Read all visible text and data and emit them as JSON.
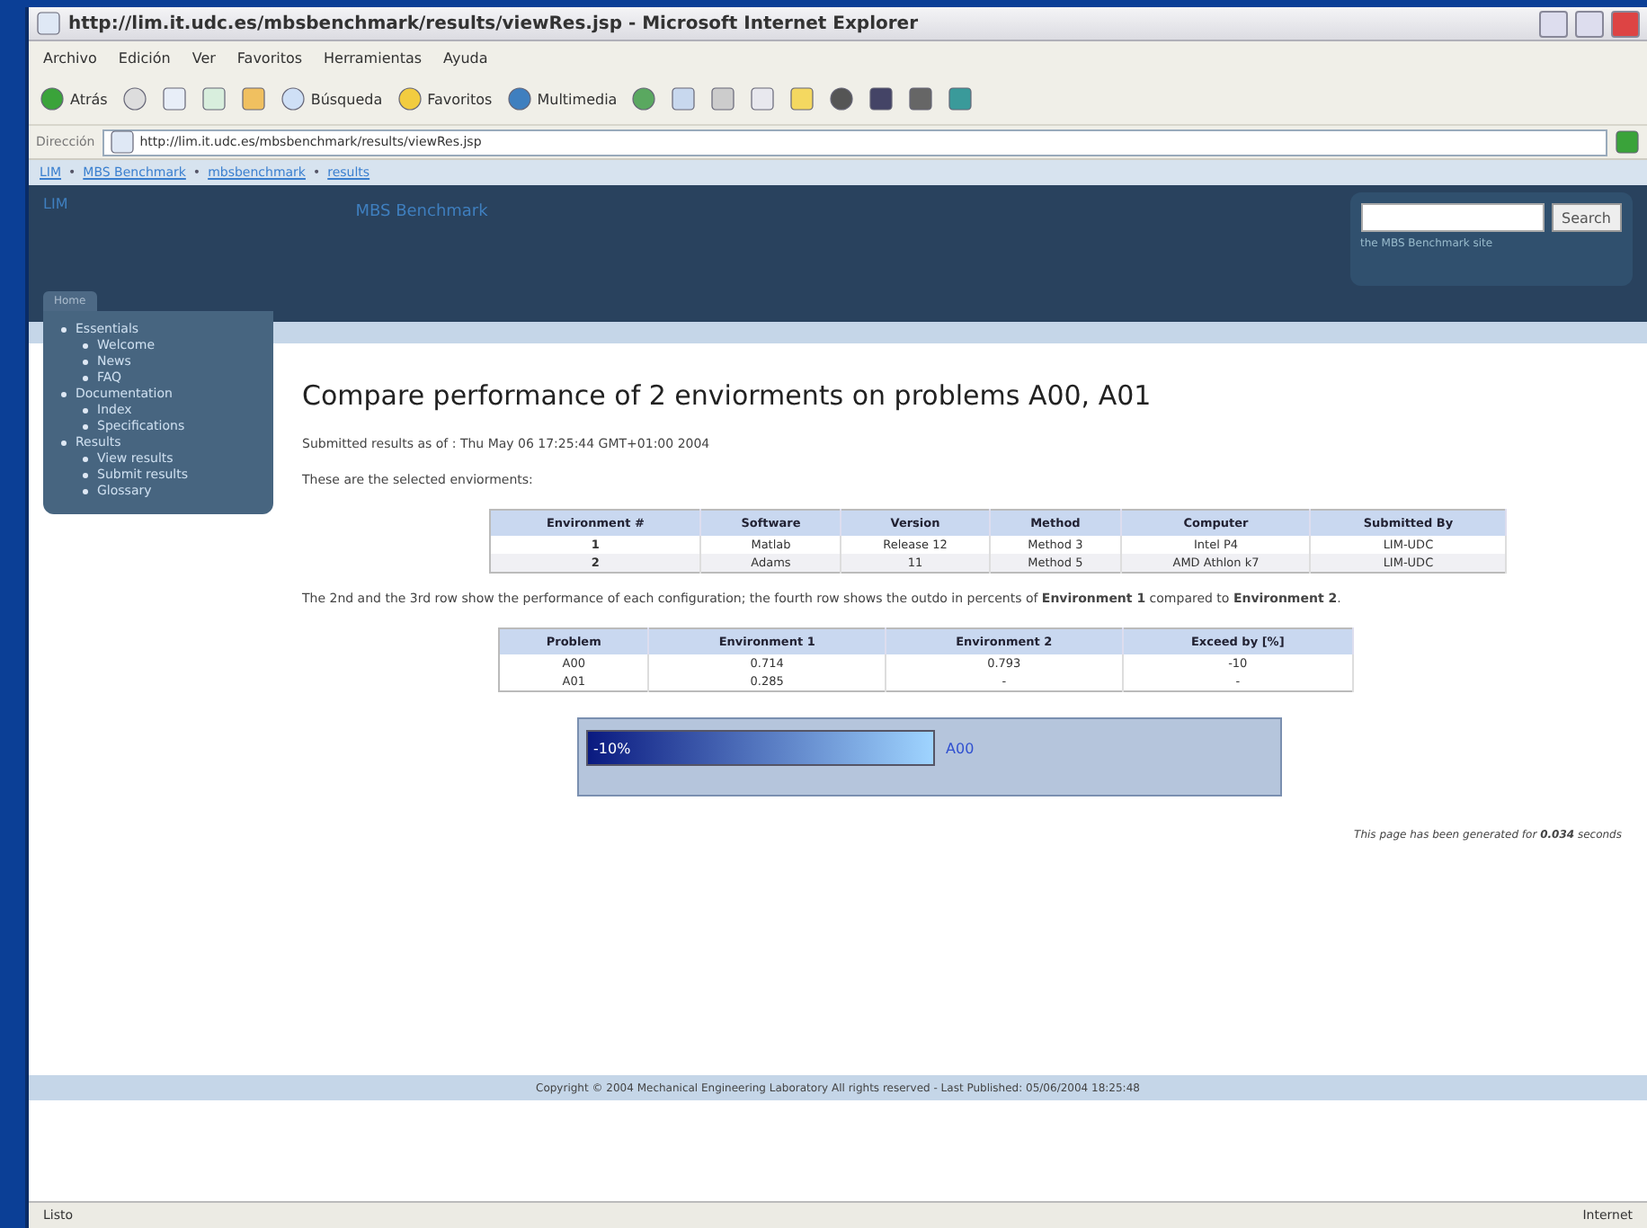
{
  "window": {
    "title": "http://lim.it.udc.es/mbsbenchmark/results/viewRes.jsp - Microsoft Internet Explorer"
  },
  "menu": [
    "Archivo",
    "Edición",
    "Ver",
    "Favoritos",
    "Herramientas",
    "Ayuda"
  ],
  "toolbar": {
    "back": "Atrás",
    "search": "Búsqueda",
    "favorites": "Favoritos",
    "media": "Multimedia"
  },
  "address": {
    "label": "Dirección",
    "value": "http://lim.it.udc.es/mbsbenchmark/results/viewRes.jsp"
  },
  "breadcrumb": [
    "LIM",
    "MBS Benchmark",
    "mbsbenchmark",
    "results"
  ],
  "breadcrumb_separator": "•",
  "header": {
    "logo": "LIM",
    "title": "MBS Benchmark",
    "search_button": "Search",
    "search_caption": "the MBS Benchmark site",
    "tab": "Home"
  },
  "sidebar": [
    {
      "label": "Essentials",
      "children": [
        "Welcome",
        "News",
        "FAQ"
      ]
    },
    {
      "label": "Documentation",
      "children": [
        "Index",
        "Specifications"
      ]
    },
    {
      "label": "Results",
      "children": [
        "View results",
        "Submit results",
        "Glossary"
      ]
    }
  ],
  "heading": "Compare performance of 2 enviorments on problems A00, A01",
  "submitted": "Submitted results as of : Thu May 06 17:25:44 GMT+01:00 2004",
  "intro": "These are the selected enviorments:",
  "env_table": {
    "columns": [
      "Environment #",
      "Software",
      "Version",
      "Method",
      "Computer",
      "Submitted By"
    ],
    "rows": [
      [
        "1",
        "Matlab",
        "Release 12",
        "Method 3",
        "Intel P4",
        "LIM-UDC"
      ],
      [
        "2",
        "Adams",
        "11",
        "Method 5",
        "AMD Athlon k7",
        "LIM-UDC"
      ]
    ]
  },
  "explanation": "The 2nd and the 3rd row show the performance of each configuration; the fourth row shows the outdo in percents of **Environment 1** compared to **Environment 2**.",
  "perf_table": {
    "columns": [
      "Problem",
      "Environment 1",
      "Environment 2",
      "Exceed by [%]"
    ],
    "rows": [
      [
        "A00",
        "0.714",
        "0.793",
        "-10"
      ],
      [
        "A01",
        "0.285",
        "-",
        "-"
      ]
    ]
  },
  "bars": [
    {
      "value": "-10%",
      "label": "A00",
      "level": 0.5
    }
  ],
  "generated": "This page has been generated for **0.034** seconds",
  "footer": "Copyright © 2004 Mechanical Engineering Laboratory All rights reserved - Last Published: 05/06/2004 18:25:48",
  "status_bar": {
    "left": "Listo",
    "right": "Internet"
  }
}
